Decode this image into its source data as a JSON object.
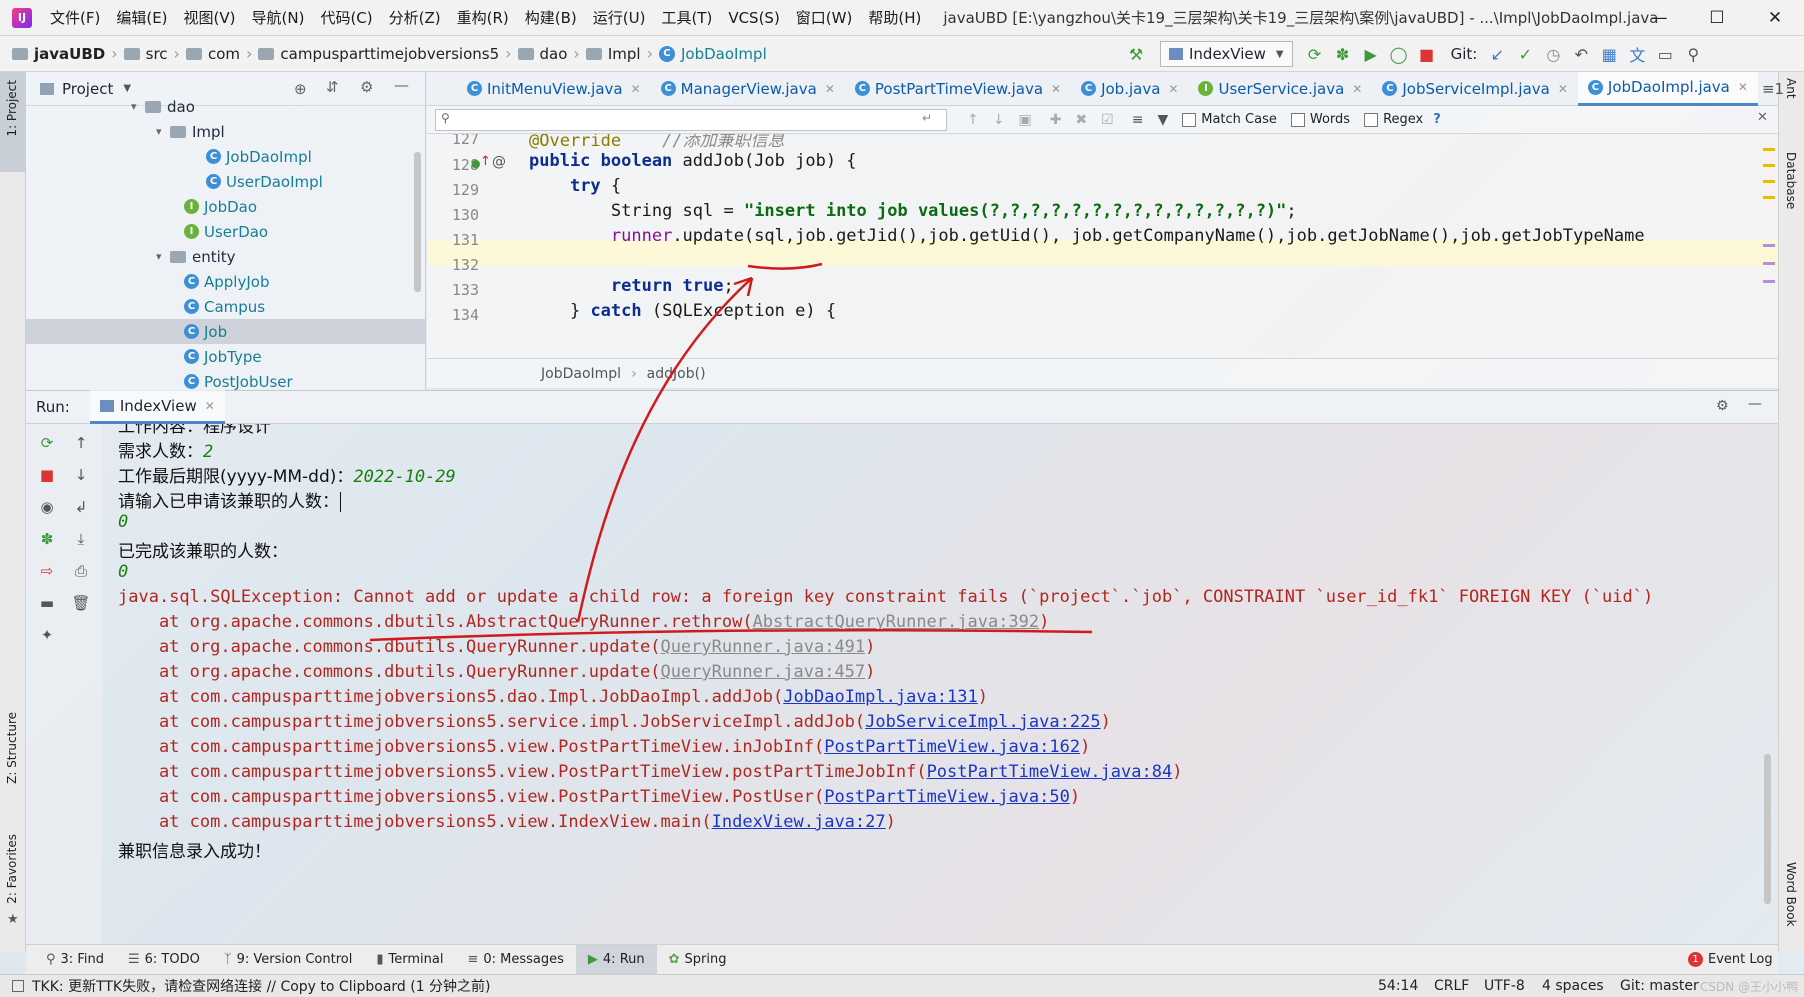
{
  "menu": {
    "items": [
      "文件(F)",
      "编辑(E)",
      "视图(V)",
      "导航(N)",
      "代码(C)",
      "分析(Z)",
      "重构(R)",
      "构建(B)",
      "运行(U)",
      "工具(T)",
      "VCS(S)",
      "窗口(W)",
      "帮助(H)"
    ],
    "window_title": "javaUBD [E:\\yangzhou\\关卡19_三层架构\\关卡19_三层架构\\案例\\javaUBD] - ...\\Impl\\JobDaoImpl.java"
  },
  "breadcrumb": [
    "javaUBD",
    "src",
    "com",
    "campusparttimejobversions5",
    "dao",
    "Impl",
    "JobDaoImpl"
  ],
  "run_config": "IndexView",
  "git_label": "Git:",
  "project": {
    "title": "Project",
    "tree": [
      {
        "label": "dao",
        "icon": "folder-icon"
      },
      {
        "label": "Impl",
        "icon": "folder-icon"
      },
      {
        "label": "JobDaoImpl",
        "icon": "class-icon"
      },
      {
        "label": "UserDaoImpl",
        "icon": "class-icon"
      },
      {
        "label": "JobDao",
        "icon": "interface-icon"
      },
      {
        "label": "UserDao",
        "icon": "interface-icon"
      },
      {
        "label": "entity",
        "icon": "folder-icon"
      },
      {
        "label": "ApplyJob",
        "icon": "class-icon"
      },
      {
        "label": "Campus",
        "icon": "class-icon"
      },
      {
        "label": "Job",
        "icon": "class-icon"
      },
      {
        "label": "JobType",
        "icon": "class-icon"
      },
      {
        "label": "PostJobUser",
        "icon": "class-icon"
      }
    ]
  },
  "editor_tabs": [
    "InitMenuView.java",
    "ManagerView.java",
    "PostPartTimeView.java",
    "Job.java",
    "UserService.java",
    "JobServiceImpl.java",
    "JobDaoImpl.java"
  ],
  "editor_tab_overflow": "1",
  "search": {
    "placeholder": "",
    "match_case": "Match Case",
    "words": "Words",
    "regex": "Regex",
    "help": "?"
  },
  "code": {
    "line_numbers": [
      "127",
      "128",
      "129",
      "130",
      "131",
      "132",
      "133",
      "134"
    ],
    "lines": {
      "l127_annotation": "@Override",
      "l127_comment": "//添加兼职信息",
      "l128_kw": "public boolean",
      "l128_rest": " addJob(Job job) {",
      "l129_kw": "try",
      "l129_rest": " {",
      "l130_a": "String sql = ",
      "l130_str": "\"insert into job values(?,?,?,?,?,?,?,?,?,?,?,?,?,?)\"",
      "l130_b": ";",
      "l131_runner": "runner",
      "l131_rest": ".update(sql,job.getJid(),job.getUid(), job.getCompanyName(),job.getJobName(),job.getJobTypeName",
      "l133_kw": "return true",
      "l133_rest": ";",
      "l134_a": "} ",
      "l134_kw": "catch",
      "l134_rest": " (SQLException e) {"
    },
    "breadcrumb": [
      "JobDaoImpl",
      "addJob()"
    ]
  },
  "run": {
    "label": "Run:",
    "tab": "IndexView",
    "console": {
      "line0": "工作内容：程序设计",
      "line1_label": "需求人数：",
      "line1_val": "2",
      "line2_label": "工作最后期限(yyyy-MM-dd)：",
      "line2_val": "2022-10-29",
      "line3": "请输入已申请该兼职的人数：",
      "line4": "0",
      "line5": "已完成该兼职的人数：",
      "line6": "0",
      "exception_prefix": "java.sql.SQLException: ",
      "exception_msg": "Cannot add or update a child row: a foreign key constraint fails (`project`.`job`, CONSTRAINT `user_id_fk1` FOREIGN KEY (`uid`)",
      "stack": [
        {
          "pre": "    at org.apache.commons.dbutils.AbstractQueryRunner.rethrow(",
          "link": "AbstractQueryRunner.java:392",
          "post": ")",
          "style": "grey"
        },
        {
          "pre": "    at org.apache.commons.dbutils.QueryRunner.update(",
          "link": "QueryRunner.java:491",
          "post": ")",
          "style": "grey"
        },
        {
          "pre": "    at org.apache.commons.dbutils.QueryRunner.update(",
          "link": "QueryRunner.java:457",
          "post": ")",
          "style": "grey"
        },
        {
          "pre": "    at com.campusparttimejobversions5.dao.Impl.JobDaoImpl.addJob(",
          "link": "JobDaoImpl.java:131",
          "post": ")",
          "style": "blue"
        },
        {
          "pre": "    at com.campusparttimejobversions5.service.impl.JobServiceImpl.addJob(",
          "link": "JobServiceImpl.java:225",
          "post": ")",
          "style": "blue"
        },
        {
          "pre": "    at com.campusparttimejobversions5.view.PostPartTimeView.inJobInf(",
          "link": "PostPartTimeView.java:162",
          "post": ")",
          "style": "blue"
        },
        {
          "pre": "    at com.campusparttimejobversions5.view.PostPartTimeView.postPartTimeJobInf(",
          "link": "PostPartTimeView.java:84",
          "post": ")",
          "style": "blue"
        },
        {
          "pre": "    at com.campusparttimejobversions5.view.PostPartTimeView.PostUser(",
          "link": "PostPartTimeView.java:50",
          "post": ")",
          "style": "blue"
        },
        {
          "pre": "    at com.campusparttimejobversions5.view.IndexView.main(",
          "link": "IndexView.java:27",
          "post": ")",
          "style": "blue"
        }
      ],
      "final_line": "兼职信息录入成功！"
    }
  },
  "bottom_tools": [
    {
      "label": "3: Find",
      "icon": "search-icon"
    },
    {
      "label": "6: TODO",
      "icon": "todo-icon"
    },
    {
      "label": "9: Version Control",
      "icon": "vcs-icon"
    },
    {
      "label": "Terminal",
      "icon": "terminal-icon"
    },
    {
      "label": "0: Messages",
      "icon": "messages-icon"
    },
    {
      "label": "4: Run",
      "icon": "run-icon"
    },
    {
      "label": "Spring",
      "icon": "spring-icon"
    }
  ],
  "event_log": {
    "count": "1",
    "label": "Event Log"
  },
  "left_vtabs": [
    "1: Project",
    "Z: Structure",
    "2: Favorites"
  ],
  "right_vtabs": [
    "Ant",
    "Database",
    "Word Book"
  ],
  "status": {
    "message": "TKK: 更新TTK失败，请检查网络连接 // Copy to Clipboard (1 分钟之前)",
    "position": "54:14",
    "line_sep": "CRLF",
    "encoding": "UTF-8",
    "indent": "4 spaces",
    "git": "Git: master",
    "watermark": "CSDN @王小小鸭"
  },
  "colors": {
    "accent": "#4a88c7",
    "error": "#b3261e",
    "annotation_red": "#d11a1a",
    "string": "#0b6b10",
    "keyword": "#0b2e8f"
  }
}
